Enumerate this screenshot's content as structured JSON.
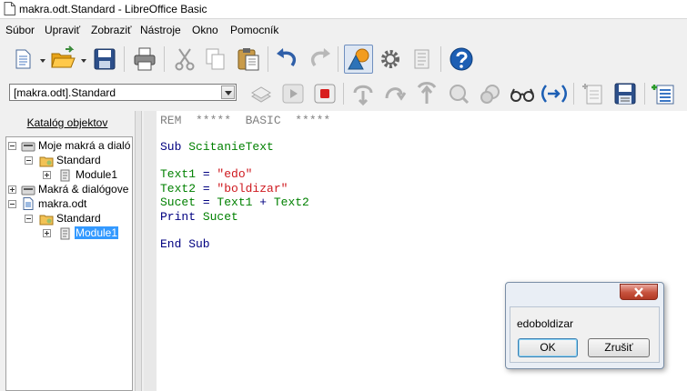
{
  "window": {
    "title": "makra.odt.Standard - LibreOffice Basic"
  },
  "menubar": {
    "items": [
      {
        "label": "Súbor"
      },
      {
        "label": "Upraviť"
      },
      {
        "label": "Zobraziť"
      },
      {
        "label": "Nástroje"
      },
      {
        "label": "Okno"
      },
      {
        "label": "Pomocník"
      }
    ]
  },
  "toolbar": {
    "library_combo": "[makra.odt].Standard"
  },
  "catalog": {
    "title": "Katalóg objektov",
    "tree": [
      {
        "label": "Moje makrá a dialó",
        "icon": "macro-container-icon"
      },
      {
        "label": "Standard",
        "icon": "library-folder-icon"
      },
      {
        "label": "Module1",
        "icon": "module-icon"
      },
      {
        "label": "Makrá & dialógove",
        "icon": "macro-container-icon"
      },
      {
        "label": "makra.odt",
        "icon": "document-icon"
      },
      {
        "label": "Standard",
        "icon": "library-folder-icon"
      },
      {
        "label": "Module1",
        "icon": "module-icon",
        "selected": true
      }
    ]
  },
  "editor": {
    "line1": {
      "a": "REM  *****  BASIC  *****"
    },
    "line3": {
      "a": "Sub ",
      "b": "ScitanieText"
    },
    "line5": {
      "a": "Text1",
      "b": " = ",
      "c": "\"edo\""
    },
    "line6": {
      "a": "Text2",
      "b": " = ",
      "c": "\"boldizar\""
    },
    "line7": {
      "a": "Sucet",
      "b": " = ",
      "c": "Text1",
      "d": " + ",
      "e": "Text2"
    },
    "line8": {
      "a": "Print ",
      "b": "Sucet"
    },
    "line10": {
      "a": "End Sub"
    }
  },
  "dialog": {
    "message": "edoboldizar",
    "ok_label": "OK",
    "cancel_label": "Zrušiť"
  },
  "colors": {
    "keyword": "#000080",
    "comment": "#808080",
    "identifier": "#008000",
    "string": "#ce181e",
    "selection": "#3399ff"
  }
}
